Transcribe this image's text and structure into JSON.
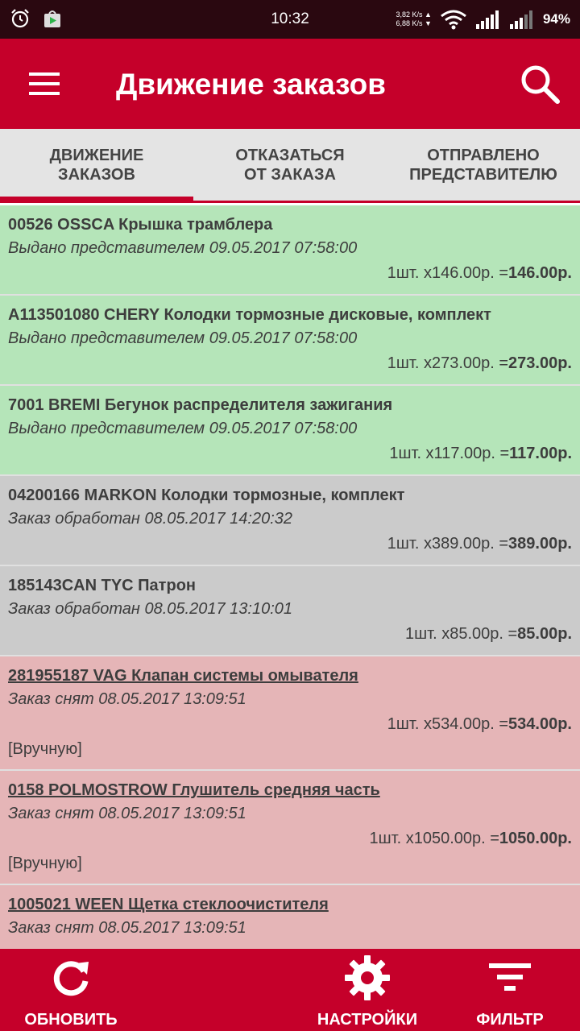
{
  "status_bar": {
    "time": "10:32",
    "speed_up": "3,82 K/s ▲",
    "speed_down": "6,88 K/s ▼",
    "battery": "94%",
    "icons": [
      "alarm-icon",
      "play-store-icon",
      "wifi-icon",
      "signal-icon",
      "signal-icon-2"
    ]
  },
  "app_bar": {
    "title": "Движение заказов",
    "menu_icon": "menu-icon",
    "search_icon": "search-icon"
  },
  "tabs": [
    {
      "label": "ДВИЖЕНИЕ\nЗАКАЗОВ",
      "active": true
    },
    {
      "label": "ОТКАЗАТЬСЯ\nОТ ЗАКАЗА",
      "active": false
    },
    {
      "label": "ОТПРАВЛЕНО\nПРЕДСТАВИТЕЛЮ",
      "active": false
    }
  ],
  "colors": {
    "accent": "#c5002a",
    "issued": "#b5e5b9",
    "processed": "#cbcbcb",
    "cancelled": "#e5b5b7"
  },
  "orders": [
    {
      "title": "00526 OSSCA Крышка трамблера",
      "status": "Выдано представителем  09.05.2017 07:58:00",
      "qty_price": "1шт. х146.00р. =",
      "total": "146.00р."
    },
    {
      "title": "A113501080 CHERY Колодки тормозные дисковые, комплект",
      "status": "Выдано представителем  09.05.2017 07:58:00",
      "qty_price": "1шт. х273.00р. =",
      "total": "273.00р."
    },
    {
      "title": "7001 BREMI Бегунок распределителя зажигания",
      "status": "Выдано представителем  09.05.2017 07:58:00",
      "qty_price": "1шт. х117.00р. =",
      "total": "117.00р."
    },
    {
      "title": "04200166 MARKON Колодки тормозные, комплект",
      "status": "Заказ обработан  08.05.2017 14:20:32",
      "qty_price": "1шт. х389.00р. =",
      "total": "389.00р."
    },
    {
      "title": "185143CAN TYC Патрон",
      "status": "Заказ обработан  08.05.2017 13:10:01",
      "qty_price": "1шт. х85.00р. =",
      "total": "85.00р."
    },
    {
      "title": "281955187 VAG Клапан системы омывателя ",
      "status": "Заказ снят  08.05.2017 13:09:51",
      "qty_price": "1шт. х534.00р. =",
      "total": "534.00р.",
      "note": "[Вручную]"
    },
    {
      "title": "0158 POLMOSTROW Глушитель средняя часть ",
      "status": "Заказ снят  08.05.2017 13:09:51",
      "qty_price": "1шт. х1050.00р. =",
      "total": "1050.00р.",
      "note": "[Вручную]"
    },
    {
      "title": "1005021 WEEN Щетка стеклоочистителя ",
      "status": "Заказ снят  08.05.2017 13:09:51"
    }
  ],
  "bottom_bar": {
    "refresh_label": "ОБНОВИТЬ",
    "settings_label": "НАСТРОЙКИ",
    "filter_label": "ФИЛЬТР",
    "refresh_icon": "refresh-icon",
    "settings_icon": "gear-icon",
    "filter_icon": "filter-icon"
  }
}
